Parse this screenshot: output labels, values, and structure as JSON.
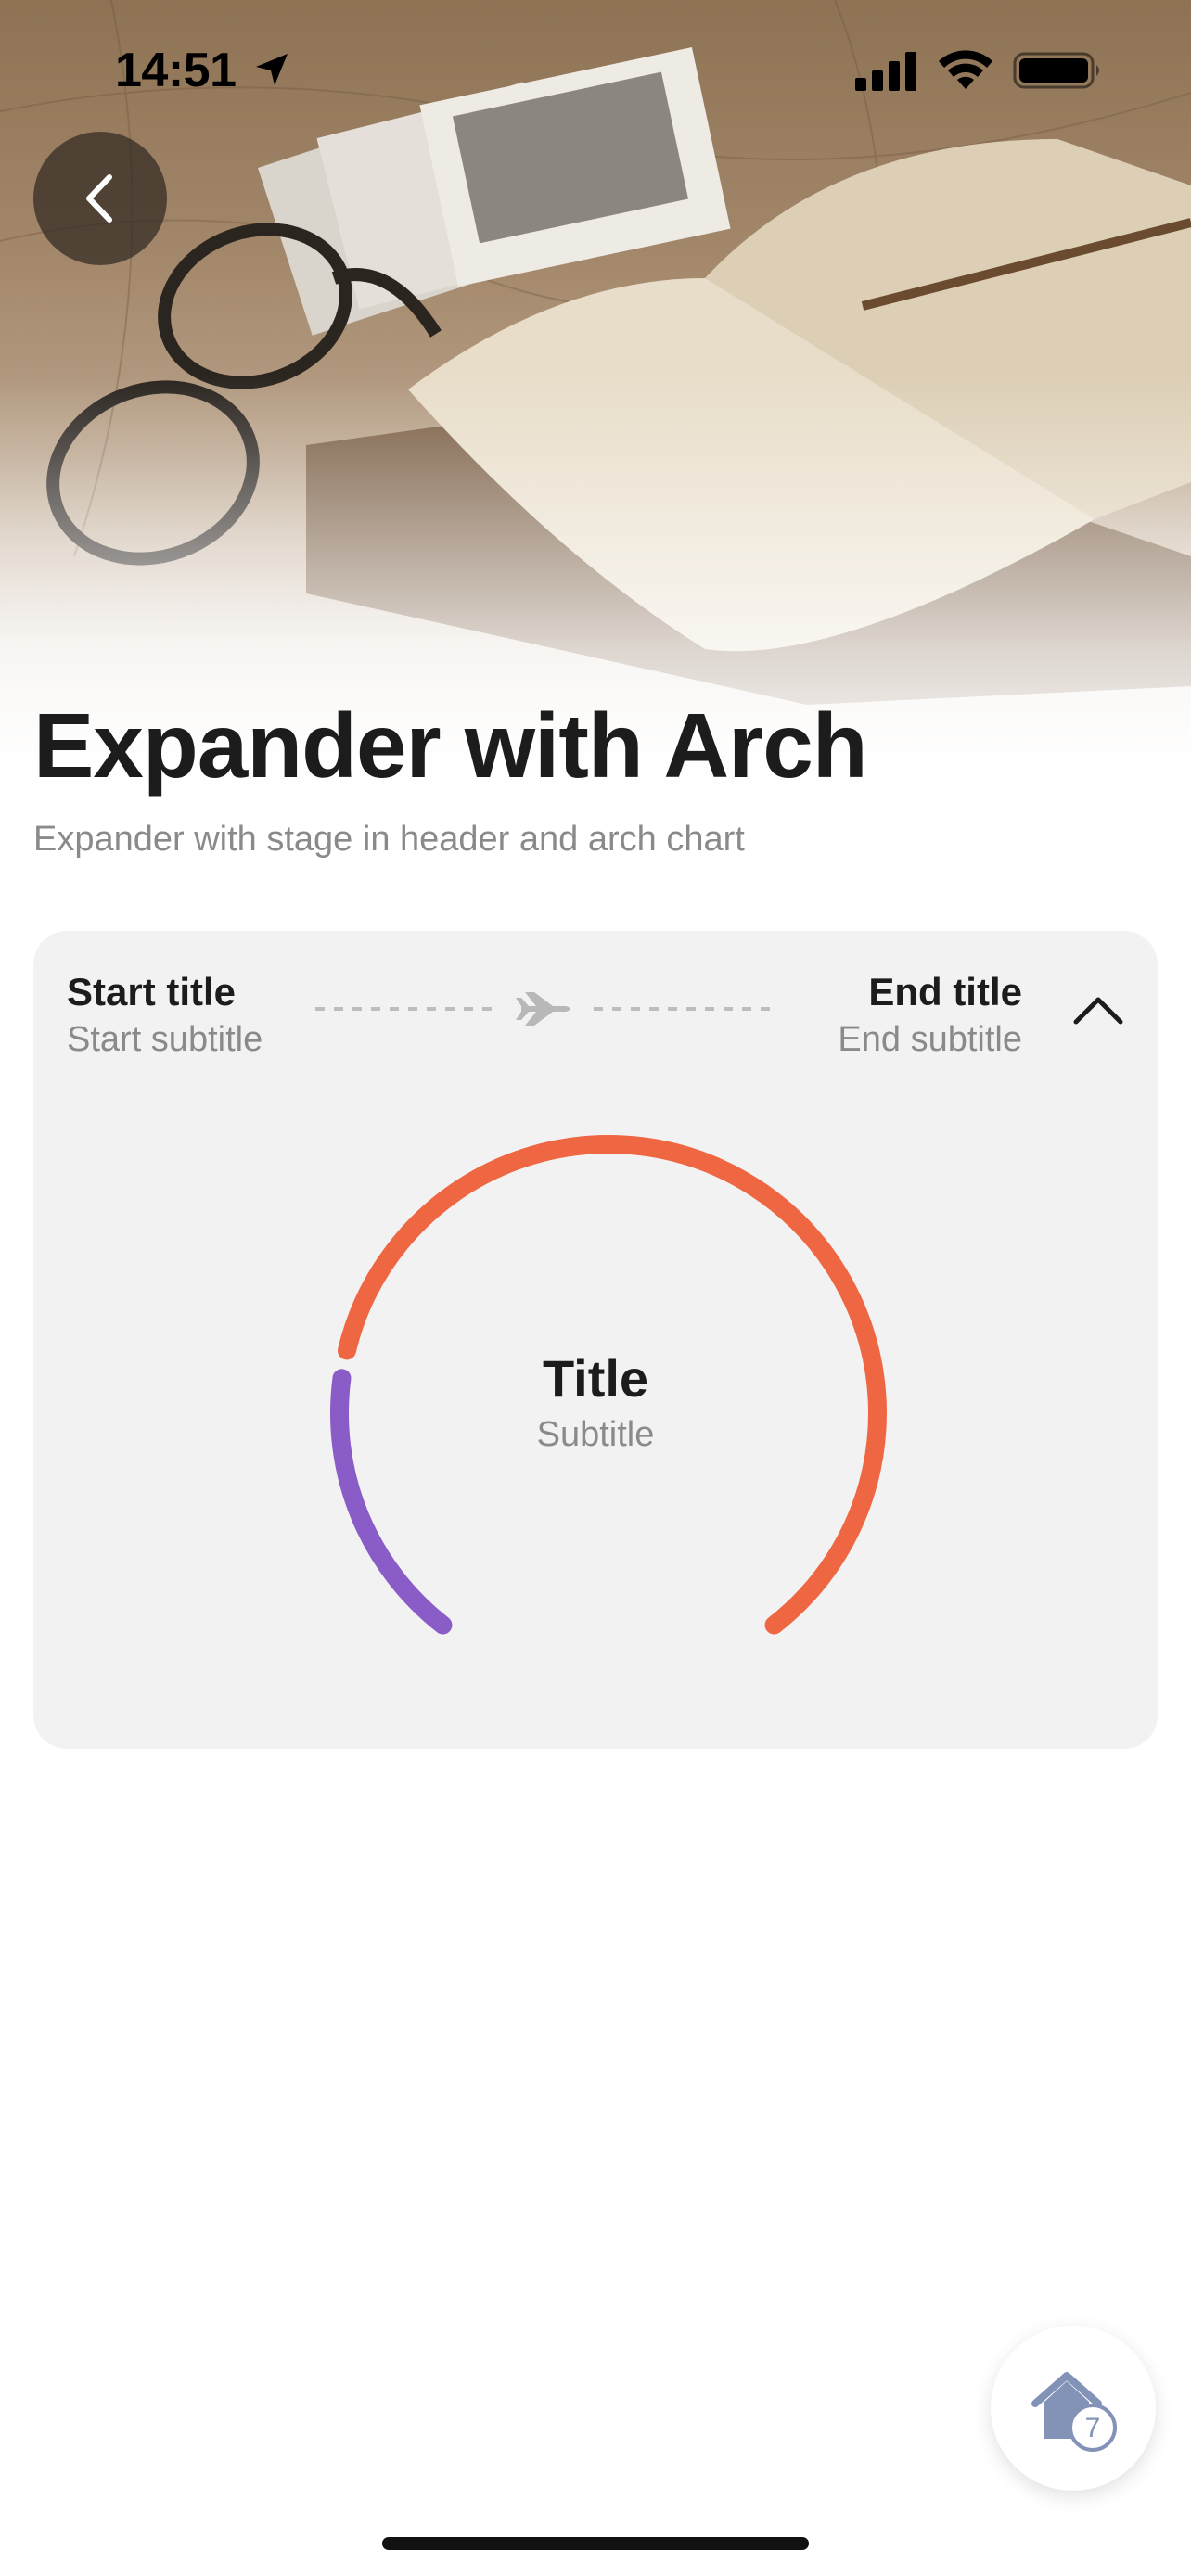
{
  "status_bar": {
    "time": "14:51",
    "icons": [
      "location-arrow-icon",
      "cellular-signal-icon",
      "wifi-icon",
      "battery-icon"
    ]
  },
  "header": {
    "back_icon": "chevron-left-icon",
    "title": "Expander with Arch",
    "subtitle": "Expander with stage in header and arch chart"
  },
  "card": {
    "stage": {
      "start_title": "Start title",
      "start_subtitle": "Start subtitle",
      "end_title": "End title",
      "end_subtitle": "End subtitle",
      "connector_icon": "airplane-icon",
      "toggle_icon": "chevron-up-icon"
    },
    "arch": {
      "title": "Title",
      "subtitle": "Subtitle",
      "segments": [
        {
          "color": "#8a5cc7",
          "fraction": 0.22
        },
        {
          "color": "#ef6643",
          "fraction": 0.78
        }
      ]
    }
  },
  "fab": {
    "icon": "home-icon",
    "badge": "7"
  },
  "colors": {
    "accent_purple": "#8a5cc7",
    "accent_orange": "#ef6643",
    "card_bg": "#f2f2f2",
    "text_primary": "#1c1c1c",
    "text_secondary": "#8a8a8a"
  }
}
